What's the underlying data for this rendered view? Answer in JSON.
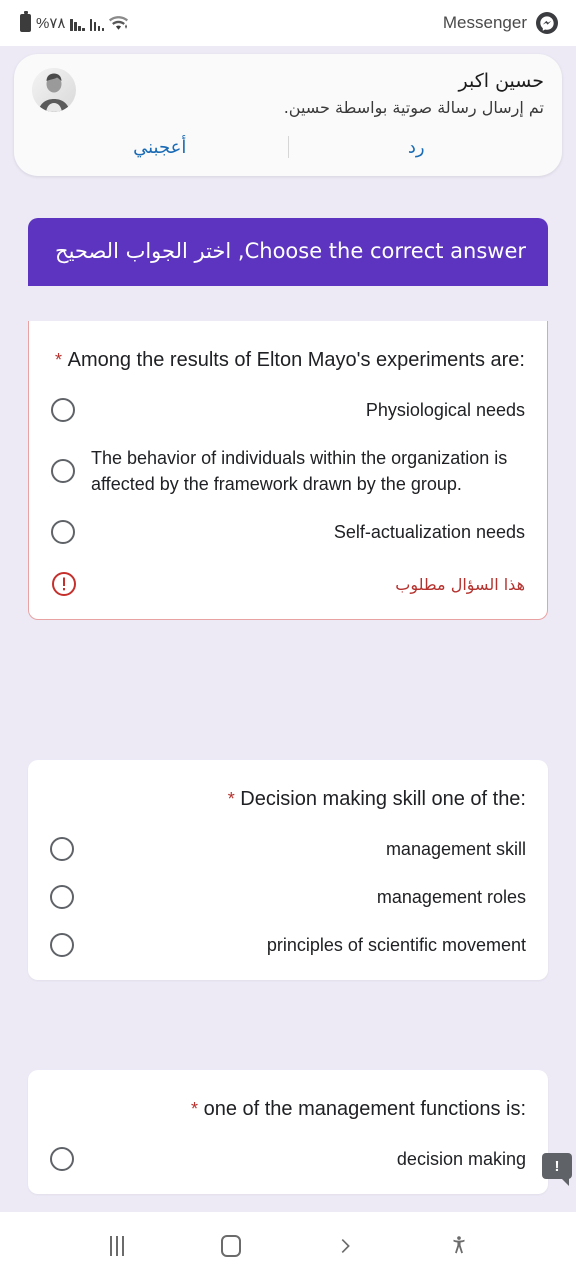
{
  "statusbar": {
    "battery_percent": "%٧٨",
    "app_label": "Messenger",
    "icons": {
      "battery": "battery-icon",
      "signal_1": "signal-bars-icon",
      "signal_2": "signal-bars-icon",
      "wifi": "wifi-icon",
      "messenger": "messenger-icon"
    }
  },
  "notification": {
    "sender": "حسين اكبر",
    "message": "تم إرسال رسالة صوتية بواسطة حسين.",
    "actions": {
      "like": "أعجبني",
      "reply": "رد"
    }
  },
  "form": {
    "header_title": "Choose the correct answer, اختر الجواب الصحيح",
    "required_star": "*",
    "questions": [
      {
        "title": "Among the results of Elton Mayo's experiments are:",
        "required": true,
        "has_error": true,
        "error_text": "هذا السؤال مطلوب",
        "options": [
          "Physiological needs",
          "The behavior of individuals within the organization is affected by the framework drawn by the group.",
          "Self-actualization needs"
        ]
      },
      {
        "title": "Decision making skill one of the:",
        "required": true,
        "has_error": false,
        "options": [
          "management skill",
          "management roles",
          "principles of scientific movement"
        ]
      },
      {
        "title": "one of the management functions is:",
        "required": true,
        "has_error": false,
        "options": [
          "decision making"
        ]
      }
    ]
  },
  "tooltip_badge": {
    "label": "!"
  },
  "navbar": {
    "recents_label": "recents",
    "home_label": "home",
    "back_label": "back",
    "accessibility_label": "accessibility"
  },
  "colors": {
    "form_accent": "#5c34bf",
    "page_background": "#edeaf6",
    "error": "#b5322e",
    "link": "#1a6bb5",
    "card": "#ffffff"
  }
}
